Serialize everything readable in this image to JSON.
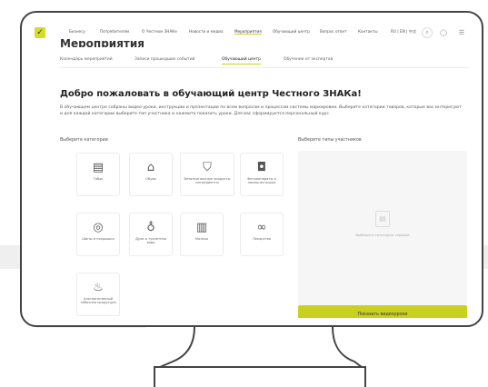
{
  "nav": {
    "items": [
      {
        "label": "Бизнесу",
        "active": false
      },
      {
        "label": "Потребителям",
        "active": false
      },
      {
        "label": "О Честном ЗНАКе",
        "active": false
      },
      {
        "label": "Новости и медиа",
        "active": false
      },
      {
        "label": "Мероприятия",
        "active": true
      },
      {
        "label": "Обучающий центр",
        "active": false
      },
      {
        "label": "Вопрос ответ",
        "active": false
      },
      {
        "label": "Контакты",
        "active": false
      }
    ],
    "lang": "RU | EN | 中文",
    "search_icon": "search-icon",
    "logo_icon": "logo-icon"
  },
  "page_title": "Мероприятия",
  "tabs": [
    {
      "label": "Календарь мероприятий",
      "active": false
    },
    {
      "label": "Записи прошедших событий",
      "active": false
    },
    {
      "label": "Обучающий центр",
      "active": true
    },
    {
      "label": "Обучение от экспертов",
      "active": false
    }
  ],
  "welcome_title": "Добро пожаловать в обучающий центр Честного ЗНАКа!",
  "description": "В обучающем центре собраны видео-уроки, инструкции и презентации по всем вопросам и процессам системы маркировки. Выберите категории товаров, которые вас интересуют и для каждой категории выберите тип участника и нажмите показать уроки. Для вас сформируется персональный курс.",
  "categories_label": "Выберите категории",
  "participants_label": "Выберите типы участников",
  "categories": [
    {
      "label": "Табак",
      "icon": "tobacco-icon"
    },
    {
      "label": "Обувь",
      "icon": "shoe-icon"
    },
    {
      "label": "Безалкогольные продукты ингредиенты",
      "icon": "clothing-icon"
    },
    {
      "label": "Фотоаппараты и лампы-вспышки",
      "icon": "camera-icon"
    },
    {
      "label": "Шины и покрышки",
      "icon": "tire-icon"
    },
    {
      "label": "Духи и туалетная вода",
      "icon": "perfume-icon"
    },
    {
      "label": "Молоко",
      "icon": "milk-icon"
    },
    {
      "label": "Лекарства",
      "icon": "medicine-icon"
    },
    {
      "label": "Альтернативный табачная продукция",
      "icon": "alt-tobacco-icon"
    }
  ],
  "panel_hint": "Выберите категории товаров",
  "show_button": "Показать видеоуроки",
  "accent_color": "#c8d11f"
}
